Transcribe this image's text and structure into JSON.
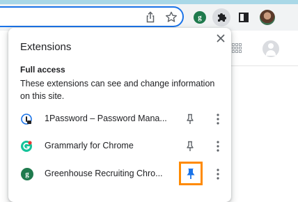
{
  "toolbar": {
    "icons": [
      "share-icon",
      "bookmark-star-icon",
      "greenhouse-extension-icon",
      "extensions-puzzle-icon",
      "side-panel-icon",
      "profile-avatar"
    ],
    "greenhouse_letter": "g",
    "accent_color": "#1a73e8"
  },
  "popup": {
    "title": "Extensions",
    "section_title": "Full access",
    "section_description": "These extensions can see and change information on this site.",
    "extensions": [
      {
        "name": "1Password – Password Mana...",
        "icon": "1password-icon",
        "pinned": false
      },
      {
        "name": "Grammarly for Chrome",
        "icon": "grammarly-icon",
        "pinned": false
      },
      {
        "name": "Greenhouse Recruiting Chro...",
        "icon": "greenhouse-icon",
        "icon_letter": "g",
        "pinned": true
      }
    ],
    "highlight_color": "#ff8a00"
  }
}
